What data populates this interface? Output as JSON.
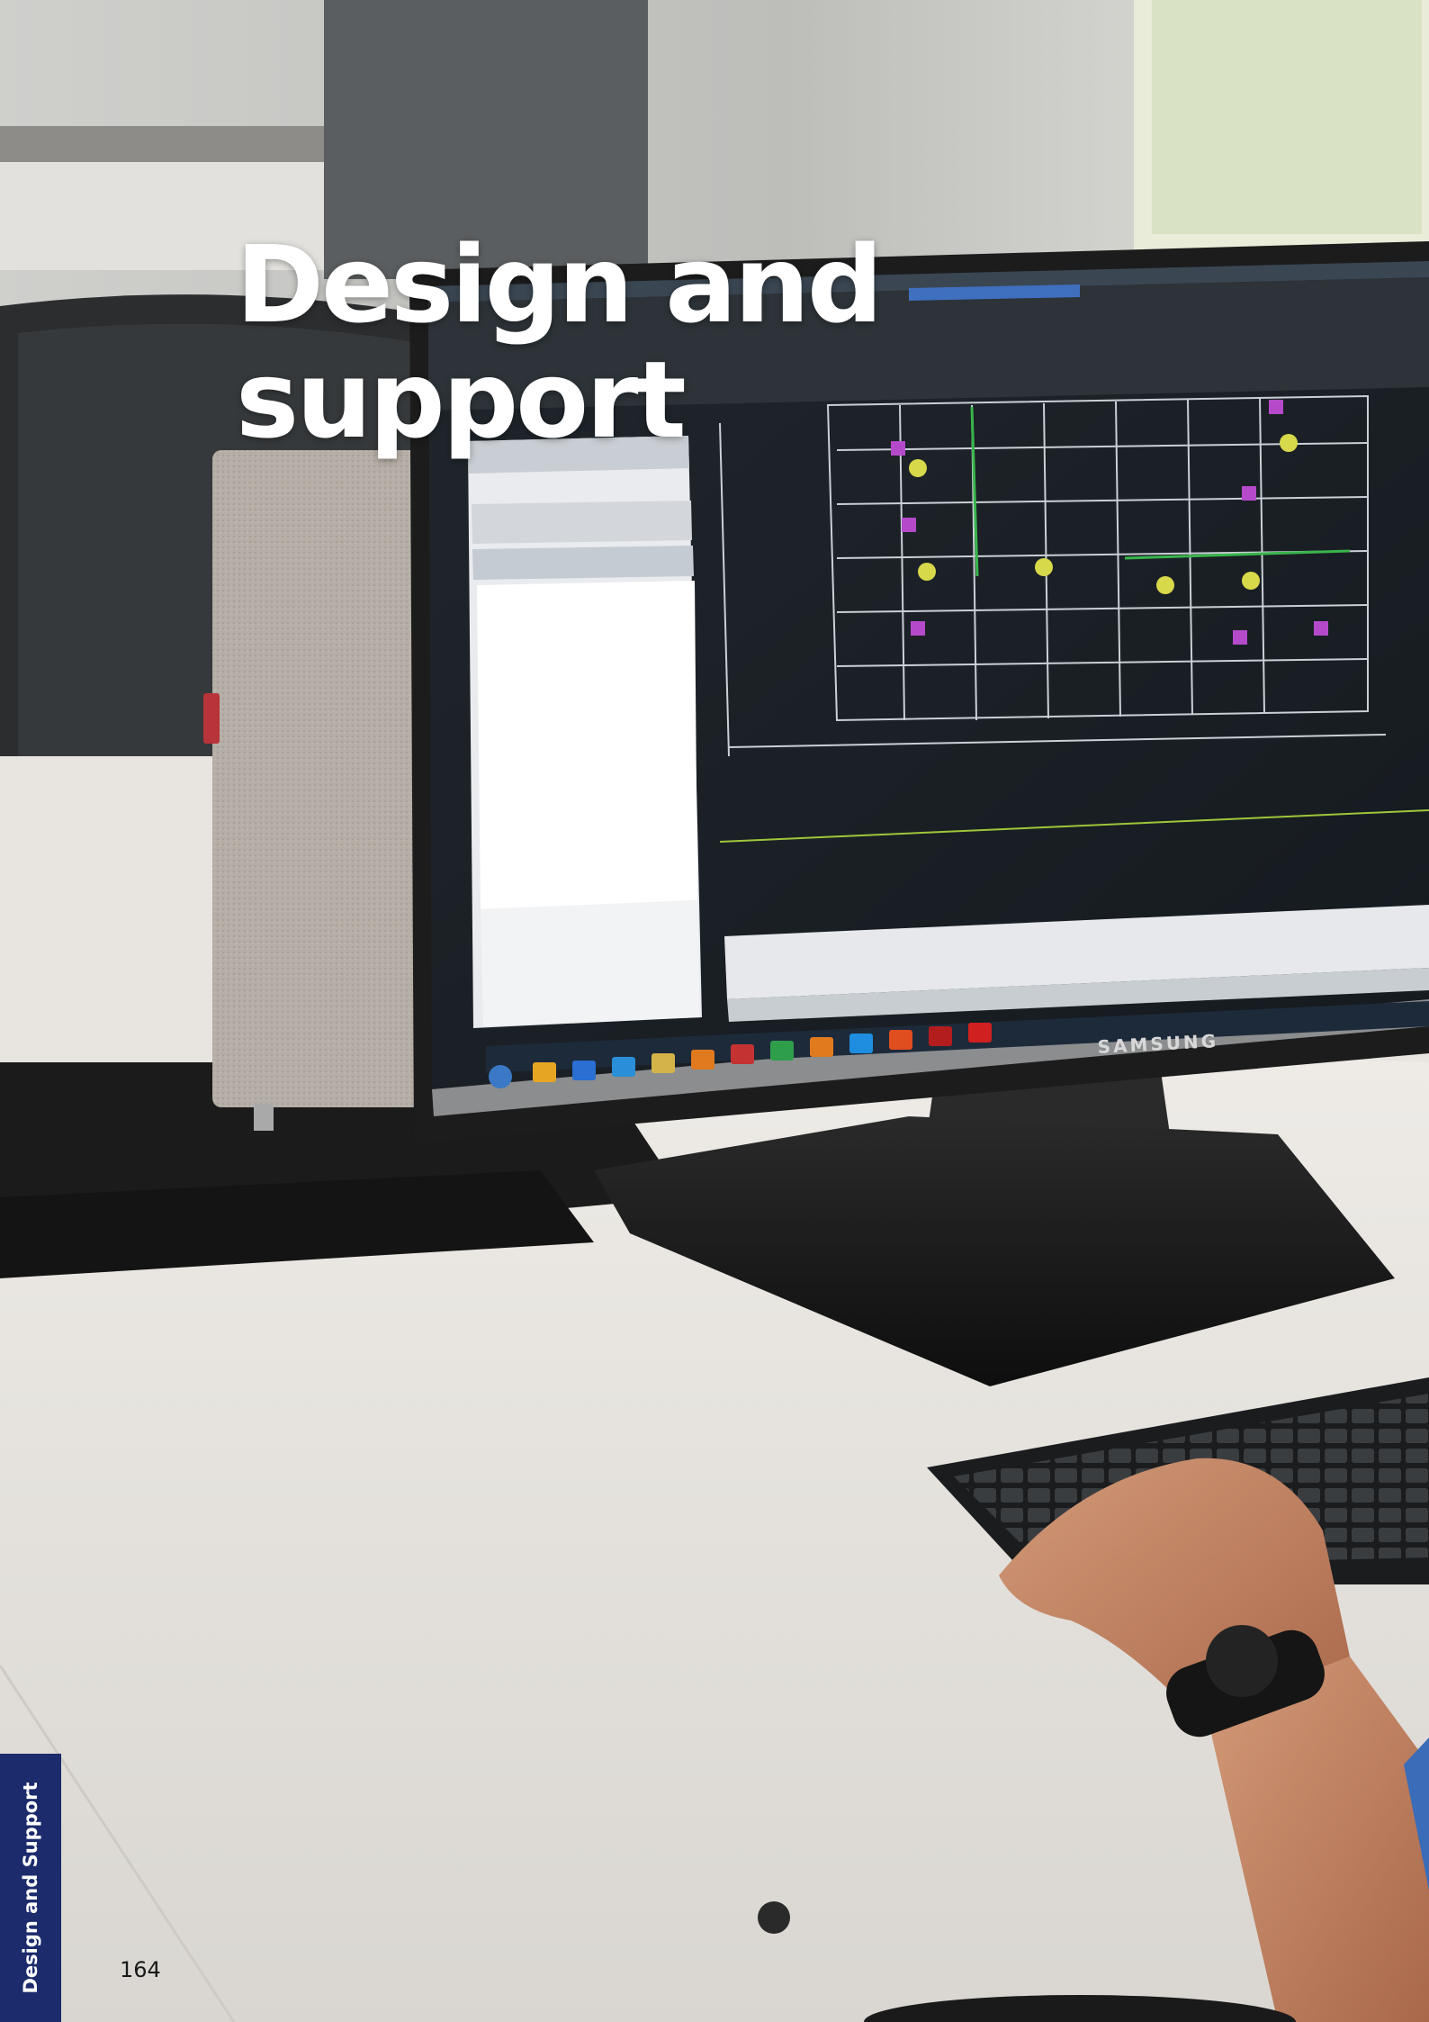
{
  "page": {
    "headline_line1": "Design and",
    "headline_line2": "support",
    "section_tab_label": "Design and Support",
    "page_number": "164"
  },
  "photo": {
    "monitor_brand": "SAMSUNG",
    "colors": {
      "desk": "#e6e3df",
      "monitor_bezel": "#1c1c1c",
      "cad_background": "#1e2329",
      "section_tab": "#1b2b6b"
    }
  }
}
